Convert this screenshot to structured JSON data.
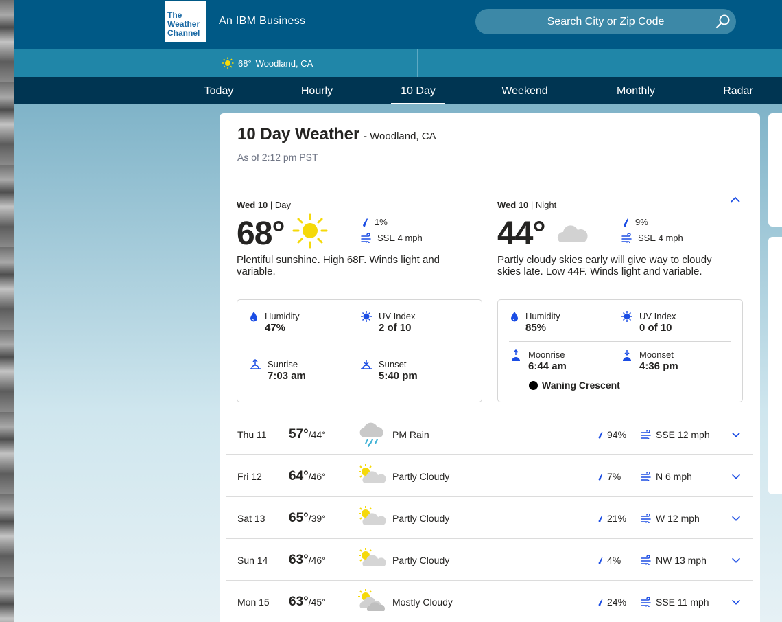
{
  "header": {
    "logo_lines": [
      "The",
      "Weather",
      "Channel"
    ],
    "ibm_tag": "An IBM Business",
    "search_placeholder": "Search City or Zip Code"
  },
  "location_bar": {
    "temp": "68°",
    "location": "Woodland, CA"
  },
  "nav": {
    "tabs": [
      {
        "label": "Today"
      },
      {
        "label": "Hourly"
      },
      {
        "label": "10 Day",
        "active": true
      },
      {
        "label": "Weekend"
      },
      {
        "label": "Monthly"
      },
      {
        "label": "Radar"
      }
    ]
  },
  "page": {
    "title": "10 Day Weather",
    "subtitle": "- Woodland, CA",
    "as_of": "As of 2:12 pm PST"
  },
  "today": {
    "day": {
      "date": "Wed 10",
      "period": "| Day",
      "temp": "68°",
      "icon": "sunny-icon",
      "precip": "1%",
      "wind": "SSE 4 mph",
      "narrative": "Plentiful sunshine. High 68F. Winds light and variable.",
      "details": {
        "humidity_label": "Humidity",
        "humidity": "47%",
        "uv_label": "UV Index",
        "uv": "2 of 10",
        "sunrise_label": "Sunrise",
        "sunrise": "7:03 am",
        "sunset_label": "Sunset",
        "sunset": "5:40 pm"
      }
    },
    "night": {
      "date": "Wed 10",
      "period": "| Night",
      "temp": "44°",
      "icon": "cloudy-night-icon",
      "precip": "9%",
      "wind": "SSE 4 mph",
      "narrative": "Partly cloudy skies early will give way to cloudy skies late. Low 44F. Winds light and variable.",
      "details": {
        "humidity_label": "Humidity",
        "humidity": "85%",
        "uv_label": "UV Index",
        "uv": "0 of 10",
        "moonrise_label": "Moonrise",
        "moonrise": "6:44 am",
        "moonset_label": "Moonset",
        "moonset": "4:36 pm",
        "moon_phase": "Waning Crescent"
      }
    }
  },
  "days": [
    {
      "name": "Thu 11",
      "hi": "57°",
      "lo": "/44°",
      "icon": "rain-icon",
      "phrase": "PM Rain",
      "precip": "94%",
      "wind": "SSE 12 mph"
    },
    {
      "name": "Fri 12",
      "hi": "64°",
      "lo": "/46°",
      "icon": "partly-cloudy-icon",
      "phrase": "Partly Cloudy",
      "precip": "7%",
      "wind": "N 6 mph"
    },
    {
      "name": "Sat 13",
      "hi": "65°",
      "lo": "/39°",
      "icon": "partly-cloudy-icon",
      "phrase": "Partly Cloudy",
      "precip": "21%",
      "wind": "W 12 mph"
    },
    {
      "name": "Sun 14",
      "hi": "63°",
      "lo": "/46°",
      "icon": "partly-cloudy-icon",
      "phrase": "Partly Cloudy",
      "precip": "4%",
      "wind": "NW 13 mph"
    },
    {
      "name": "Mon 15",
      "hi": "63°",
      "lo": "/45°",
      "icon": "mostly-cloudy-icon",
      "phrase": "Mostly Cloudy",
      "precip": "24%",
      "wind": "SSE 11 mph"
    }
  ],
  "colors": {
    "header_bg": "#005986",
    "location_bar_bg": "#2086a8",
    "nav_bg": "#003552",
    "accent_blue": "#1b4de4",
    "sun_yellow": "#f5d90a"
  }
}
